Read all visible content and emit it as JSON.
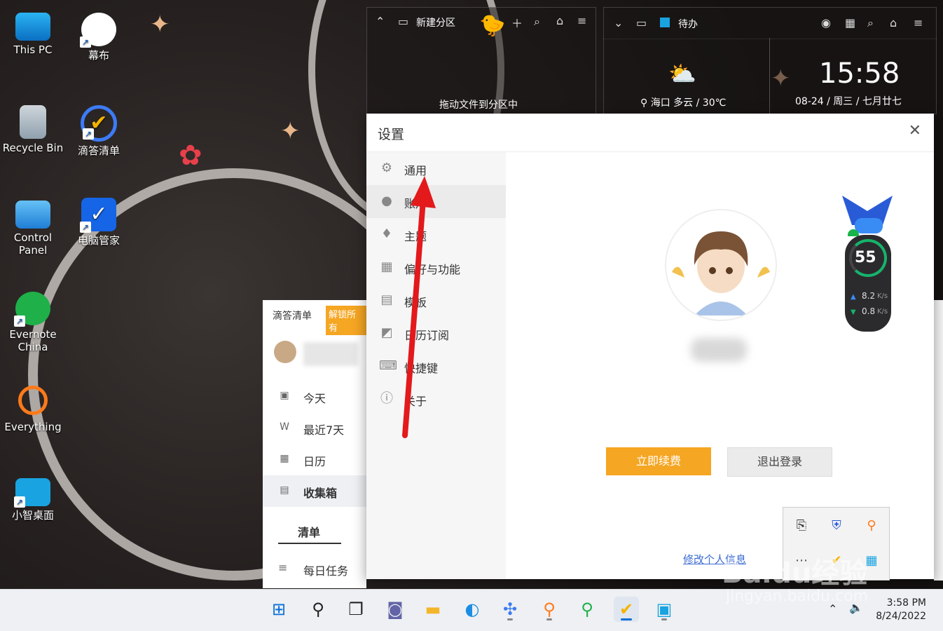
{
  "desktop_icons": [
    {
      "label": "This PC"
    },
    {
      "label": "幕布"
    },
    {
      "label": "Recycle Bin"
    },
    {
      "label": "滴答清单"
    },
    {
      "label": "Control Panel"
    },
    {
      "label": "电脑管家"
    },
    {
      "label": "Evernote China"
    },
    {
      "label": "Everything"
    },
    {
      "label": "小智桌面"
    }
  ],
  "partition_widget": {
    "title": "新建分区",
    "hint": "拖动文件到分区中"
  },
  "todo_widget": {
    "title": "待办"
  },
  "weather": {
    "text": "海口 多云 / 30℃"
  },
  "clock_widget": {
    "time": "15:58",
    "date": "08-24 / 周三 / 七月廿七"
  },
  "settings": {
    "title": "设置",
    "sidebar": [
      {
        "label": "通用",
        "icon": "gear-icon"
      },
      {
        "label": "账户",
        "icon": "user-icon"
      },
      {
        "label": "主题",
        "icon": "paint-icon"
      },
      {
        "label": "偏好与功能",
        "icon": "grid-icon"
      },
      {
        "label": "模板",
        "icon": "clipboard-icon"
      },
      {
        "label": "日历订阅",
        "icon": "rss-icon"
      },
      {
        "label": "快捷键",
        "icon": "keyboard-icon"
      },
      {
        "label": "关于",
        "icon": "info-icon"
      }
    ],
    "renew_label": "立即续费",
    "logout_label": "退出登录",
    "edit_link": "修改个人信息"
  },
  "dida_app": {
    "title": "滴答清单",
    "unlock_badge": "解锁所有",
    "nav": [
      {
        "label": "今天",
        "icon": "calendar-24-icon"
      },
      {
        "label": "最近7天",
        "icon": "week-icon"
      },
      {
        "label": "日历",
        "icon": "calendar-icon"
      },
      {
        "label": "收集箱",
        "icon": "inbox-icon"
      }
    ],
    "tab_label": "清单",
    "list_item": "每日任务"
  },
  "network": {
    "percent": "55",
    "up": "8.2",
    "down": "0.8",
    "unit": "K/s"
  },
  "taskbar_clock": {
    "time": "3:58 PM",
    "date": "8/24/2022"
  },
  "watermark": {
    "main": "Baidu经验",
    "sub": "jingyan.baidu.com"
  },
  "colors": {
    "accent": "#f5a623",
    "arrow": "#e3191c",
    "link": "#3b6bd1"
  }
}
